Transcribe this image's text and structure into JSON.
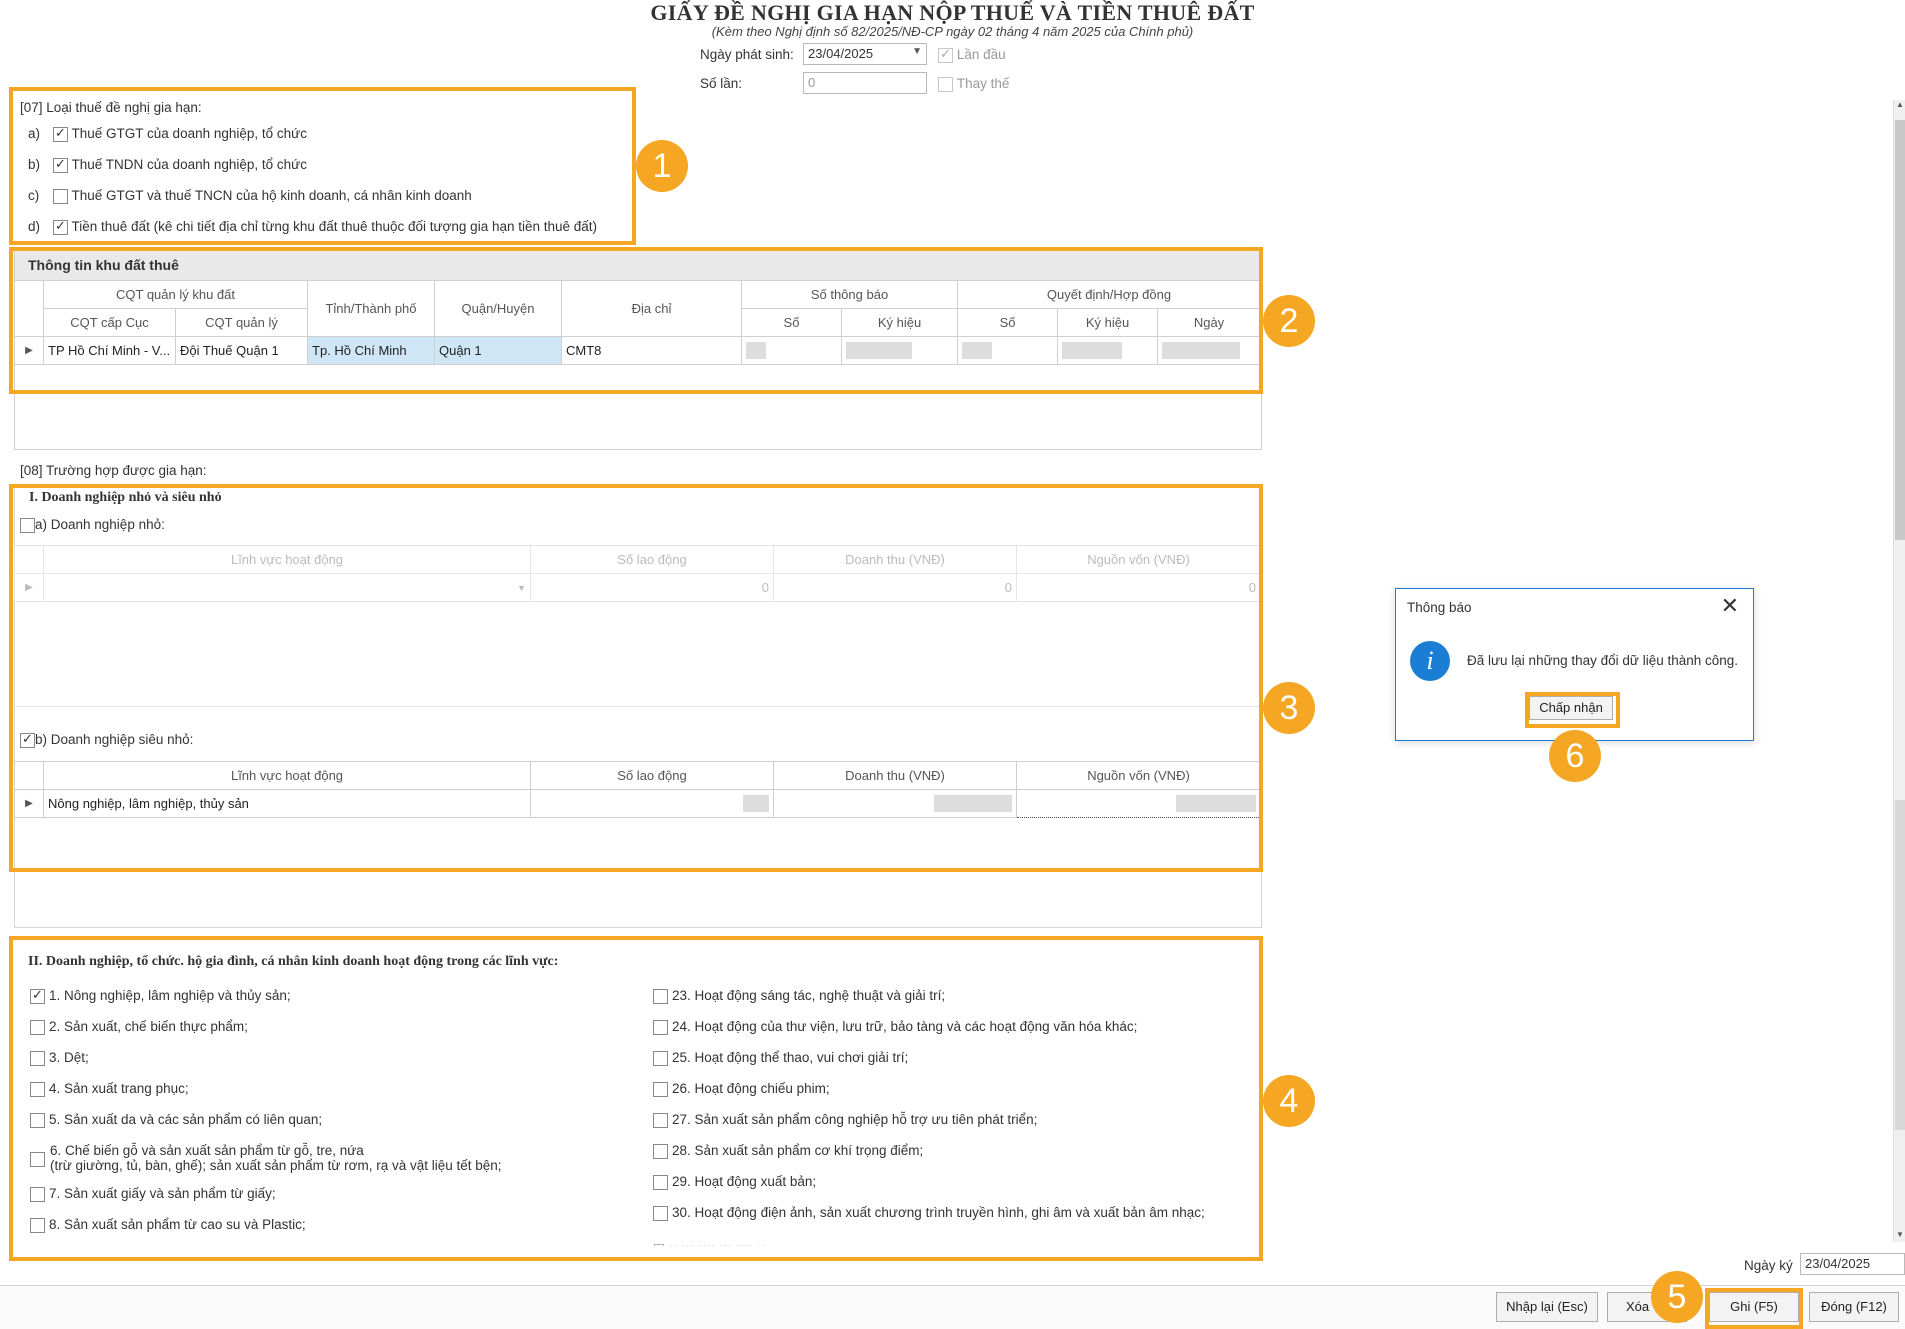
{
  "header": {
    "title": "GIẤY ĐỀ NGHỊ GIA HẠN NỘP THUẾ VÀ TIỀN THUÊ ĐẤT",
    "subtitle": "(Kèm theo Nghị định số 82/2025/NĐ-CP ngày 02 tháng 4 năm 2025 của Chính phủ)",
    "ngay_phat_sinh_label": "Ngày phát sinh:",
    "ngay_phat_sinh_value": "23/04/2025",
    "lan_dau_label": "Lần đầu",
    "so_lan_label": "Số lần:",
    "so_lan_value": "0",
    "thay_the_label": "Thay thế"
  },
  "section07": {
    "label": "[07] Loại thuế đề nghị gia hạn:",
    "items": [
      {
        "key": "a)",
        "text": "Thuế GTGT của doanh nghiệp, tổ chức",
        "checked": true
      },
      {
        "key": "b)",
        "text": "Thuế TNDN của doanh nghiệp, tổ chức",
        "checked": true
      },
      {
        "key": "c)",
        "text": "Thuế GTGT và thuế TNCN của hộ kinh doanh, cá nhân kinh doanh",
        "checked": false
      },
      {
        "key": "d)",
        "text": "Tiền thuê đất (kê chi tiết địa chỉ từng khu đất thuê thuộc đối tượng gia hạn tiền thuê đất)",
        "checked": true
      }
    ]
  },
  "land": {
    "title": "Thông tin khu đất thuê",
    "h_cqt": "CQT quản lý khu đất",
    "h_cuc": "CQT cấp Cục",
    "h_qly": "CQT quản lý",
    "h_tinh": "Tỉnh/Thành phố",
    "h_quan": "Quận/Huyện",
    "h_diachi": "Địa chỉ",
    "h_sotb": "Số thông báo",
    "h_so": "Số",
    "h_kyhieu": "Ký hiệu",
    "h_qd": "Quyết định/Hợp đồng",
    "h_so2": "Số",
    "h_kyhieu2": "Ký hiệu",
    "h_ngay": "Ngày",
    "row": {
      "cuc": "TP Hồ Chí Minh - V...",
      "qly": "Đội Thuế Quận 1",
      "tinh": "Tp. Hồ Chí Minh",
      "quan": "Quận 1",
      "diachi": "CMT8"
    }
  },
  "section08": {
    "label": "[08] Trường hợp được gia hạn:",
    "part1_title": "I. Doanh nghiệp nhỏ và siêu nhỏ",
    "a_label": "a) Doanh nghiệp nhỏ:",
    "b_label": "b) Doanh nghiệp siêu nhỏ:",
    "h_linhvuc": "Lĩnh vực hoạt động",
    "h_laodong": "Số lao động",
    "h_doanhthu": "Doanh thu (VNĐ)",
    "h_nguonvon": "Nguồn vốn (VNĐ)",
    "a_row": {
      "laodong": "0",
      "doanhthu": "0",
      "nguonvon": "0"
    },
    "b_row": {
      "linhvuc": "Nông nghiệp, lâm nghiệp, thủy sản"
    }
  },
  "part2": {
    "title": "II. Doanh nghiệp, tổ chức. hộ gia đình, cá nhân kinh doanh hoạt động trong các lĩnh vực:",
    "left": [
      {
        "text": "1. Nông nghiệp, lâm nghiệp và thủy sản;",
        "checked": true
      },
      {
        "text": "2. Sản xuất, chế biến thực phẩm;",
        "checked": false
      },
      {
        "text": "3. Dệt;",
        "checked": false
      },
      {
        "text": "4. Sản xuất trang phục;",
        "checked": false
      },
      {
        "text": "5. Sản xuất da và các sản phẩm có liên quan;",
        "checked": false
      },
      {
        "text": "6. Chế biến gỗ và sản xuất sản phẩm từ gỗ, tre, nứa",
        "text2": "(trừ giường, tủ, bàn, ghế); sản xuất sản phẩm từ rơm, rạ và vật liệu tết bện;",
        "checked": false
      },
      {
        "text": "7. Sản xuất giấy và sản phẩm từ giấy;",
        "checked": false
      },
      {
        "text": "8. Sản xuất sản phẩm từ cao su và Plastic;",
        "checked": false
      }
    ],
    "right": [
      {
        "text": "23. Hoạt động sáng tác, nghệ thuật và giải trí;",
        "checked": false
      },
      {
        "text": "24. Hoạt động của thư viện, lưu trữ, bảo tàng và các hoạt động văn hóa khác;",
        "checked": false
      },
      {
        "text": "25. Hoạt động thể thao, vui chơi giải trí;",
        "checked": false
      },
      {
        "text": "26. Hoạt động chiếu phim;",
        "checked": false
      },
      {
        "text": "27. Sản xuất sản phẩm công nghiệp hỗ trợ ưu tiên phát triển;",
        "checked": false
      },
      {
        "text": "28. Sản xuất sản phẩm cơ khí trọng điểm;",
        "checked": false
      },
      {
        "text": "29. Hoạt động xuất bản;",
        "checked": false
      },
      {
        "text": "30. Hoạt động điện ảnh, sản xuất chương trình truyền hình, ghi âm và xuất bản âm nhạc;",
        "checked": false
      }
    ]
  },
  "dialog": {
    "title": "Thông báo",
    "message": "Đã lưu lại những thay đổi dữ liệu thành công.",
    "ok": "Chấp nhận"
  },
  "footer": {
    "ngay_ky_label": "Ngày ký",
    "ngay_ky_value": "23/04/2025",
    "btn_nhaplai": "Nhập lại (Esc)",
    "btn_xoa": "Xóa",
    "btn_ghi": "Ghi (F5)",
    "btn_dong": "Đóng (F12)"
  },
  "badges": [
    "1",
    "2",
    "3",
    "4",
    "5",
    "6"
  ],
  "colors": {
    "highlight": "#f5a623",
    "info": "#1a7fd4",
    "selected_cell": "#cfe6f7"
  }
}
